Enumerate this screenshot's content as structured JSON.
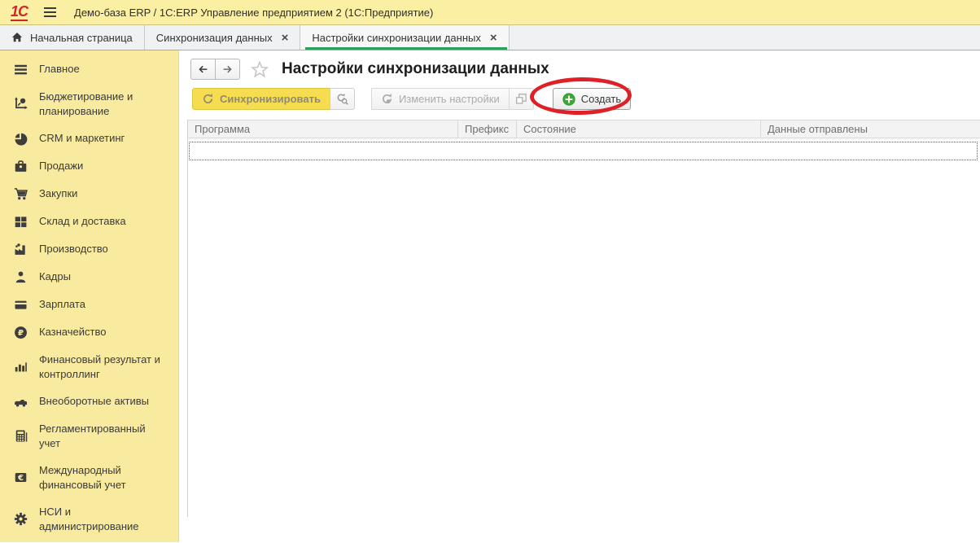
{
  "titlebar": {
    "logo": "1С",
    "title": "Демо-база ERP / 1С:ERP Управление предприятием 2  (1С:Предприятие)"
  },
  "tabs": [
    {
      "label": "Начальная страница",
      "icon": "home",
      "closable": false,
      "active": false
    },
    {
      "label": "Синхронизация данных",
      "icon": null,
      "closable": true,
      "active": false
    },
    {
      "label": "Настройки синхронизации данных",
      "icon": null,
      "closable": true,
      "active": true
    }
  ],
  "sidebar": [
    {
      "label": "Главное",
      "icon": "menu"
    },
    {
      "label": "Бюджетирование и планирование",
      "icon": "planning"
    },
    {
      "label": "CRM и маркетинг",
      "icon": "pie"
    },
    {
      "label": "Продажи",
      "icon": "briefcase"
    },
    {
      "label": "Закупки",
      "icon": "cart"
    },
    {
      "label": "Склад и доставка",
      "icon": "blocks"
    },
    {
      "label": "Производство",
      "icon": "factory"
    },
    {
      "label": "Кадры",
      "icon": "person"
    },
    {
      "label": "Зарплата",
      "icon": "card"
    },
    {
      "label": "Казначейство",
      "icon": "ruble"
    },
    {
      "label": "Финансовый результат и контроллинг",
      "icon": "bars"
    },
    {
      "label": "Внеоборотные активы",
      "icon": "car"
    },
    {
      "label": "Регламентированный учет",
      "icon": "calculator"
    },
    {
      "label": "Международный финансовый учет",
      "icon": "euro"
    },
    {
      "label": "НСИ и администрирование",
      "icon": "gear"
    }
  ],
  "page": {
    "title": "Настройки синхронизации данных"
  },
  "toolbar": {
    "sync_label": "Синхронизировать",
    "edit_label": "Изменить настройки",
    "create_label": "Создать"
  },
  "table": {
    "columns": [
      "Программа",
      "Префикс",
      "Состояние",
      "Данные отправлены"
    ]
  },
  "colors": {
    "topbar_yellow": "#FAEFA3",
    "sidebar_yellow": "#F8EA9E",
    "sync_button_yellow": "#F6DD4F",
    "active_tab_underline_green": "#2E9E5B",
    "create_plus_green": "#3BA935",
    "annotation_red": "#DE2128"
  }
}
